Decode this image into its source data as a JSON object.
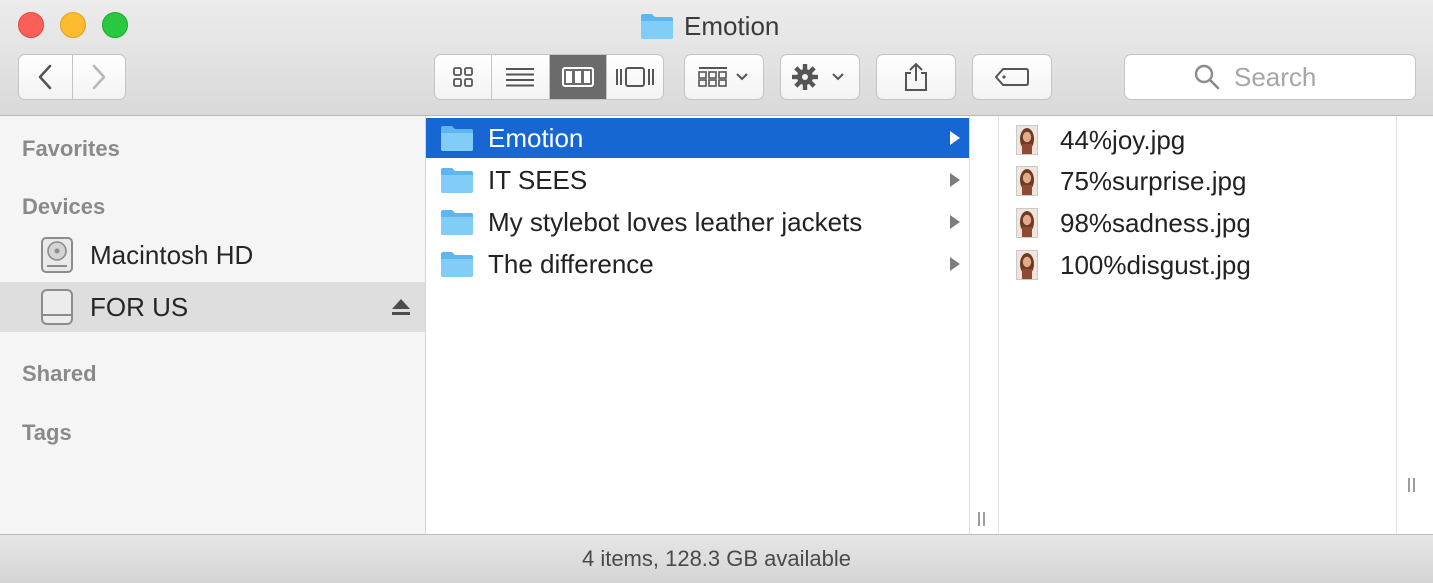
{
  "window": {
    "title": "Emotion",
    "title_icon": "folder-icon"
  },
  "toolbar": {
    "back_icon": "chevron-left-icon",
    "forward_icon": "chevron-right-icon",
    "view_modes": [
      {
        "name": "icon-view",
        "icon": "grid-icon",
        "active": false
      },
      {
        "name": "list-view",
        "icon": "list-icon",
        "active": false
      },
      {
        "name": "column-view",
        "icon": "columns-icon",
        "active": true
      },
      {
        "name": "cover-flow-view",
        "icon": "cover-flow-icon",
        "active": false
      }
    ],
    "arrange_icon": "arrange-icon",
    "action_icon": "gear-icon",
    "share_icon": "share-icon",
    "tag_icon": "tag-icon",
    "search": {
      "placeholder": "Search"
    }
  },
  "sidebar": {
    "sections": {
      "favorites": "Favorites",
      "devices": "Devices",
      "shared": "Shared",
      "tags": "Tags"
    },
    "devices": [
      {
        "label": "Macintosh HD",
        "icon": "hard-drive-icon",
        "selected": false
      },
      {
        "label": "FOR US",
        "icon": "external-drive-icon",
        "selected": true,
        "ejectable": true
      }
    ]
  },
  "columns": {
    "folders": [
      {
        "label": "Emotion",
        "selected": true
      },
      {
        "label": "IT SEES",
        "selected": false
      },
      {
        "label": "My stylebot loves leather jackets",
        "selected": false
      },
      {
        "label": "The difference",
        "selected": false
      }
    ],
    "files": [
      {
        "label": "44%joy.jpg"
      },
      {
        "label": "75%surprise.jpg"
      },
      {
        "label": "98%sadness.jpg"
      },
      {
        "label": "100%disgust.jpg"
      }
    ]
  },
  "status": {
    "text": "4 items, 128.3 GB available"
  },
  "colors": {
    "selection": "#1667d3",
    "folder": "#69bff2",
    "close": "#fc5f57",
    "minimize": "#fdbc2e",
    "zoom": "#29c840"
  }
}
